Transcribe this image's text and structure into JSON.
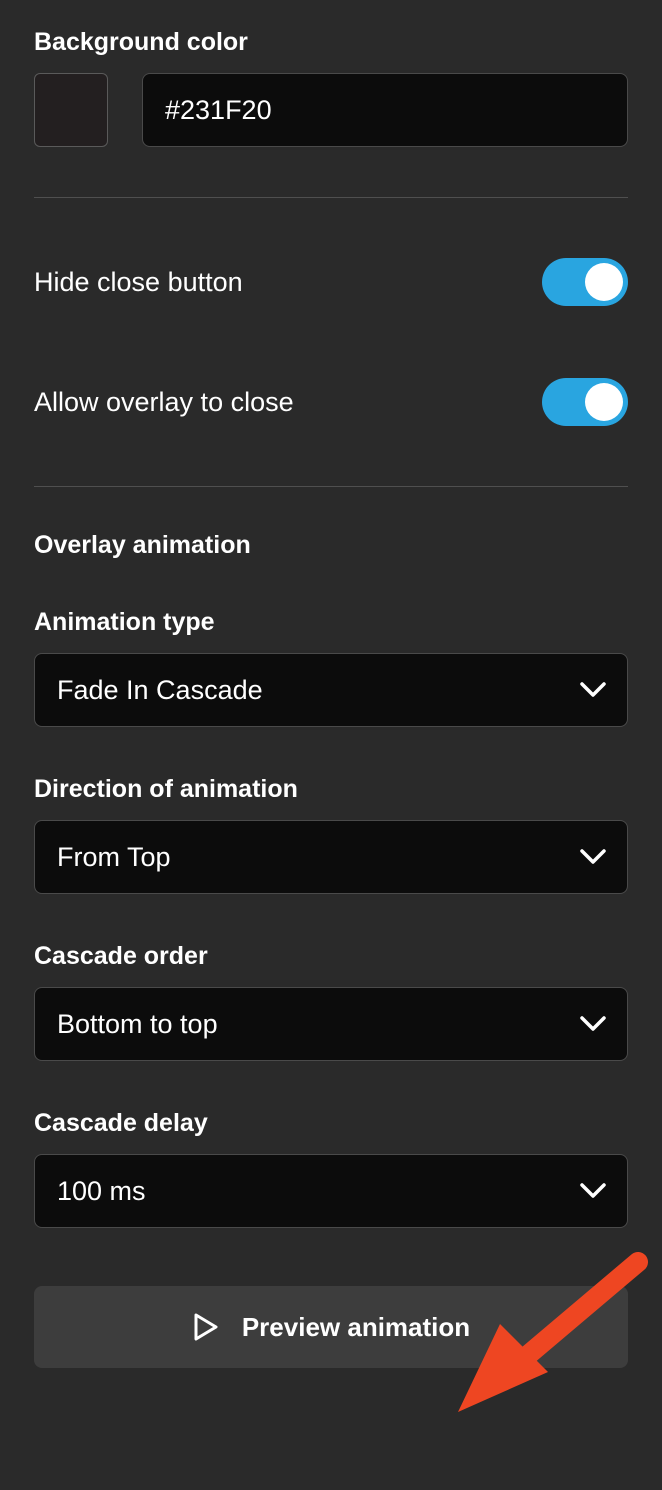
{
  "background": {
    "label": "Background color",
    "value": "#231F20",
    "swatch_color": "#231F20"
  },
  "toggles": {
    "hide_close": {
      "label": "Hide close button",
      "on": true
    },
    "allow_overlay_close": {
      "label": "Allow overlay to close",
      "on": true
    }
  },
  "overlay_animation": {
    "header": "Overlay animation",
    "animation_type": {
      "label": "Animation type",
      "value": "Fade In Cascade"
    },
    "direction": {
      "label": "Direction of animation",
      "value": "From Top"
    },
    "cascade_order": {
      "label": "Cascade order",
      "value": "Bottom to top"
    },
    "cascade_delay": {
      "label": "Cascade delay",
      "value": "100 ms"
    }
  },
  "preview_button": "Preview animation",
  "colors": {
    "accent_toggle": "#29a5e0",
    "annotation_arrow": "#ee4622"
  }
}
